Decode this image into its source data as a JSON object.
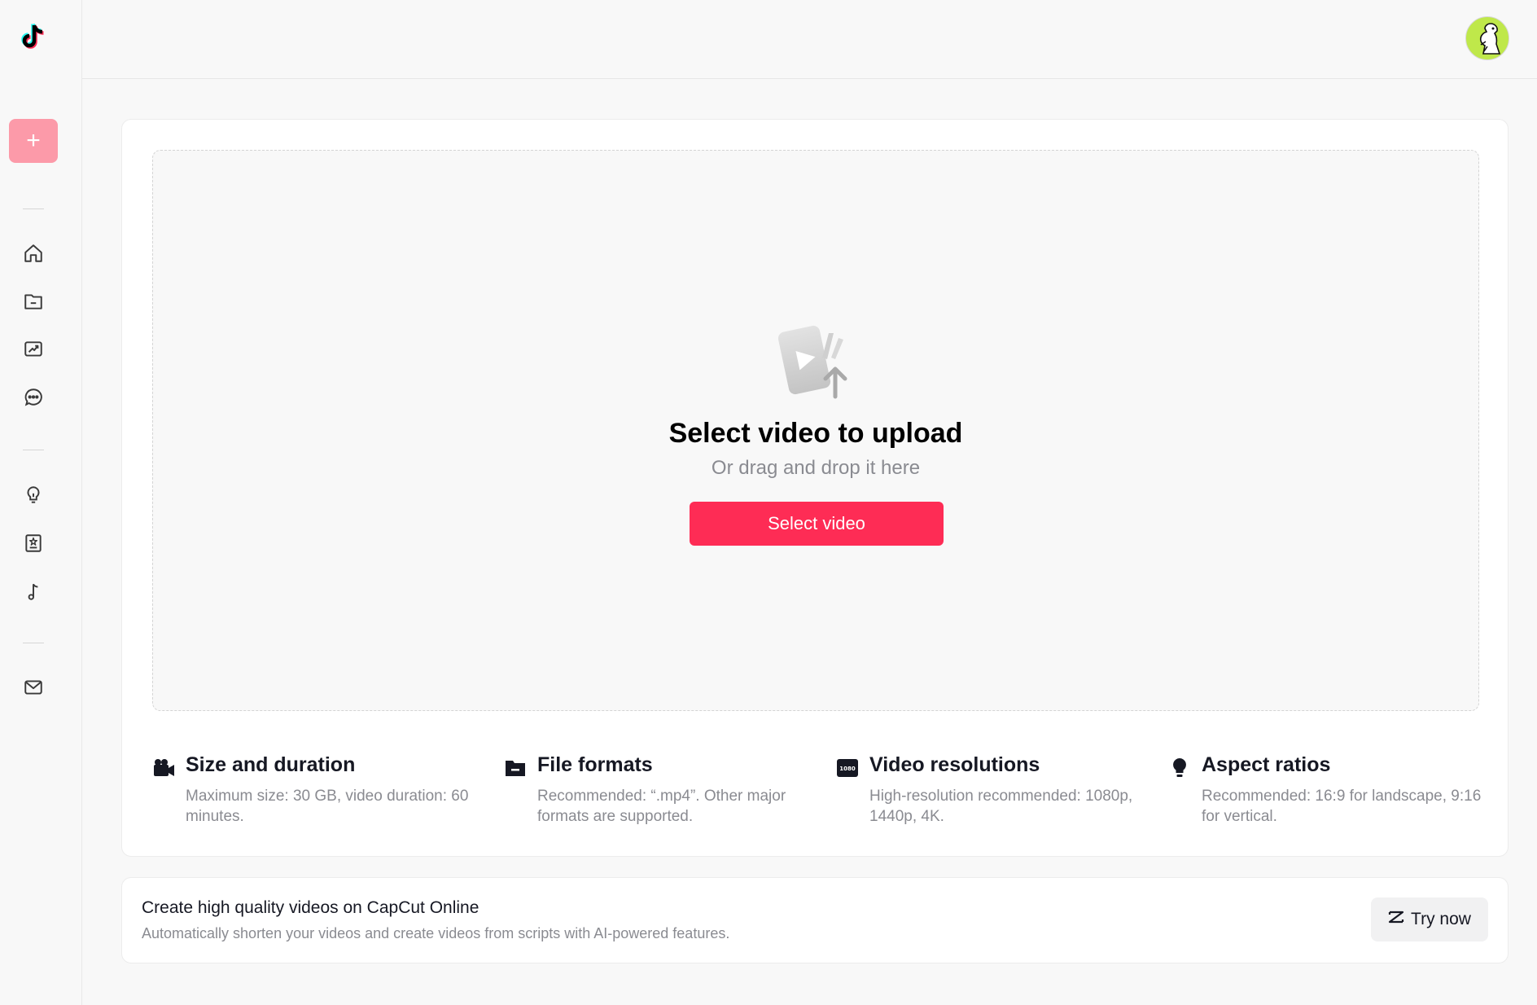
{
  "upload": {
    "title": "Select video to upload",
    "subtitle": "Or drag and drop it here",
    "button_label": "Select video"
  },
  "info": [
    {
      "icon": "video-camera-icon",
      "title": "Size and duration",
      "text": "Maximum size: 30 GB, video duration: 60 minutes."
    },
    {
      "icon": "folder-icon",
      "title": "File formats",
      "text": "Recommended: “.mp4”. Other major formats are supported."
    },
    {
      "icon": "resolution-1080-icon",
      "title": "Video resolutions",
      "text": "High-resolution recommended: 1080p, 1440p, 4K."
    },
    {
      "icon": "lightbulb-icon",
      "title": "Aspect ratios",
      "text": "Recommended: 16:9 for landscape, 9:16 for vertical."
    }
  ],
  "resolution_badge": "1080",
  "banner": {
    "title": "Create high quality videos on CapCut Online",
    "subtitle": "Automatically shorten your videos and create videos from scripts with AI-powered features.",
    "button_label": "Try now"
  },
  "sidebar": {
    "upload_button_label": "+",
    "items": [
      "home-icon",
      "folder-icon",
      "analytics-icon",
      "comments-icon",
      "lightbulb-icon",
      "creator-academy-icon",
      "music-icon",
      "mail-icon"
    ]
  },
  "colors": {
    "accent": "#fe2c55",
    "accent_light": "#fc9aa9",
    "avatar_bg": "#bfe84a"
  }
}
